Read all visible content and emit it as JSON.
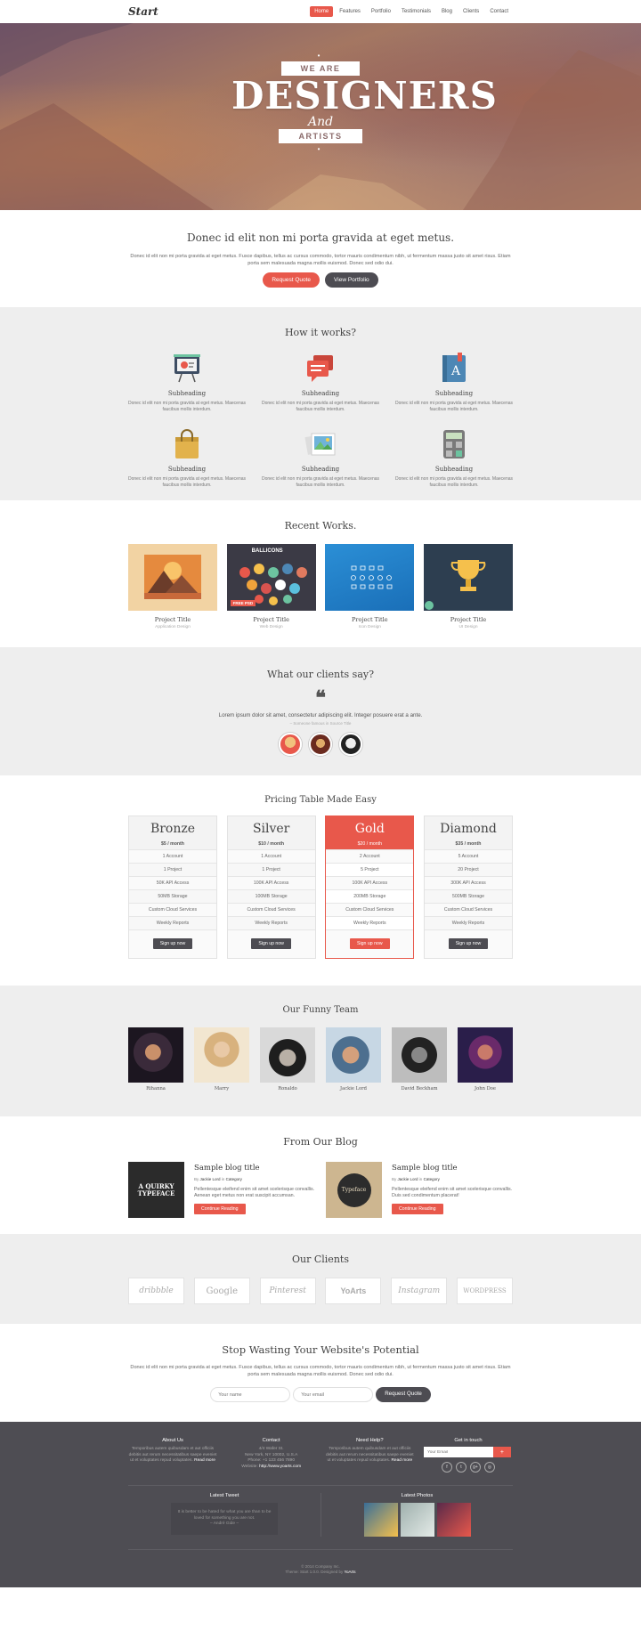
{
  "nav": {
    "logo": "Start",
    "items": [
      {
        "label": "Home"
      },
      {
        "label": "Features"
      },
      {
        "label": "Portfolio"
      },
      {
        "label": "Testimonials"
      },
      {
        "label": "Blog"
      },
      {
        "label": "Clients"
      },
      {
        "label": "Contact"
      }
    ]
  },
  "hero": {
    "ribbon_top": "WE ARE",
    "headline": "DESIGNERS",
    "connector": "And",
    "ribbon_bottom": "ARTISTS"
  },
  "intro": {
    "title": "Donec id elit non mi porta gravida at eget metus.",
    "text": "Donec id elit non mi porta gravida at eget metus. Fusce dapibus, tellus ac cursus commodo, tortor mauris condimentum nibh, ut fermentum massa justo sit amet risus. Etiam porta sem malesuada magna mollis euismod. Donec sed odio dui.",
    "primary_button": "Request Quote",
    "secondary_button": "View Portfolio"
  },
  "how": {
    "title": "How it works?",
    "features": [
      {
        "icon": "presentation-icon",
        "heading": "Subheading",
        "text": "Donec id elit non mi porta gravida at eget metus. Maecenas faucibus mollis interdum."
      },
      {
        "icon": "chat-bubbles-icon",
        "heading": "Subheading",
        "text": "Donec id elit non mi porta gravida at eget metus. Maecenas faucibus mollis interdum."
      },
      {
        "icon": "dictionary-icon",
        "heading": "Subheading",
        "text": "Donec id elit non mi porta gravida at eget metus. Maecenas faucibus mollis interdum."
      },
      {
        "icon": "shopping-bag-icon",
        "heading": "Subheading",
        "text": "Donec id elit non mi porta gravida at eget metus. Maecenas faucibus mollis interdum."
      },
      {
        "icon": "photos-icon",
        "heading": "Subheading",
        "text": "Donec id elit non mi porta gravida at eget metus. Maecenas faucibus mollis interdum."
      },
      {
        "icon": "calculator-icon",
        "heading": "Subheading",
        "text": "Donec id elit non mi porta gravida at eget metus. Maecenas faucibus mollis interdum."
      }
    ]
  },
  "works": {
    "title": "Recent Works.",
    "items": [
      {
        "title": "Project Title",
        "category": "Application Design",
        "thumb_label": ""
      },
      {
        "title": "Project Title",
        "category": "Web Design",
        "thumb_label": "BALLICONS",
        "thumb_tag": "FREE PSD"
      },
      {
        "title": "Project Title",
        "category": "Icon Design",
        "thumb_label": ""
      },
      {
        "title": "Project Title",
        "category": "UI Design",
        "thumb_label": ""
      }
    ]
  },
  "testimonials": {
    "title": "What our clients say?",
    "quote": "Lorem ipsum dolor sit amet, consectetur adipiscing elit. Integer posuere erat a ante.",
    "author": "– Someone famous in Source Title"
  },
  "pricing": {
    "title": "Pricing Table Made Easy",
    "plans": [
      {
        "name": "Bronze",
        "price": "$5 / month",
        "features": [
          "1 Account",
          "1 Project",
          "50K API Access",
          "50MB Storage",
          "Custom Cloud Services",
          "Weekly Reports"
        ],
        "button": "Sign up now"
      },
      {
        "name": "Silver",
        "price": "$10 / month",
        "features": [
          "1 Account",
          "1 Project",
          "100K API Access",
          "100MB Storage",
          "Custom Cloud Services",
          "Weekly Reports"
        ],
        "button": "Sign up now"
      },
      {
        "name": "Gold",
        "price": "$20 / month",
        "features": [
          "2 Account",
          "5 Project",
          "100K API Access",
          "200MB Storage",
          "Custom Cloud Services",
          "Weekly Reports"
        ],
        "button": "Sign up now"
      },
      {
        "name": "Diamond",
        "price": "$35 / month",
        "features": [
          "5 Account",
          "20 Project",
          "300K API Access",
          "500MB Storage",
          "Custom Cloud Services",
          "Weekly Reports"
        ],
        "button": "Sign up now"
      }
    ]
  },
  "team": {
    "title": "Our Funny Team",
    "members": [
      {
        "name": "Rihanna"
      },
      {
        "name": "Marry"
      },
      {
        "name": "Ronaldo"
      },
      {
        "name": "Jackie Lord"
      },
      {
        "name": "David Beckham"
      },
      {
        "name": "John Doe"
      }
    ]
  },
  "blog": {
    "title": "From Our Blog",
    "posts": [
      {
        "title": "Sample blog title",
        "by": "By",
        "author": "Jackie Lord",
        "in": "in",
        "category": "Category",
        "text": "Pellentesque eleifend enim sit amet scelerisque convallis. Aenean eget metus non erat suscipit accumsan.",
        "button": "Continue Reading",
        "thumb_text": "A QUIRKY TYPEFACE"
      },
      {
        "title": "Sample blog title",
        "by": "By",
        "author": "Jackie Lord",
        "in": "in",
        "category": "Category",
        "text": "Pellentesque eleifend enim sit amet scelerisque convallis. Duis sed condimentum placerat!",
        "button": "Continue Reading",
        "thumb_text": "Typeface"
      }
    ]
  },
  "clients": {
    "title": "Our Clients",
    "logos": [
      "dribbble",
      "Google",
      "Pinterest",
      "YoArts",
      "Instagram",
      "WordPress"
    ]
  },
  "cta": {
    "title": "Stop Wasting Your Website's Potential",
    "text": "Donec id elit non mi porta gravida at eget metus. Fusce dapibus, tellus ac cursus commodo, tortor mauris condimentum nibh, ut fermentum massa justo sit amet risus. Etiam porta sem malesuada magna mollis euismod. Donec sed odio dui.",
    "name_placeholder": "Your name",
    "email_placeholder": "Your email",
    "button": "Request Quote"
  },
  "footer": {
    "about": {
      "title": "About Us",
      "text": "Temporibus autem quibusdam et aut officiis debitis aut rerum necessitatibus saepe eveniet ut et voluptates repud voluptates.",
      "link": "Read more"
    },
    "contact": {
      "title": "Contact",
      "address1": "4/4 Wafer St.",
      "address2": "New York, NY 10002, U.S.A",
      "phone": "Phone: +1 123 456 7890",
      "website_label": "Website:",
      "website": "http://www.yoarts.com"
    },
    "help": {
      "title": "Need Help?",
      "text": "Temporibus autem quibusdam et aut officiis debitis aut rerum necessitatibus saepe eveniet ut et voluptates repud voluptates.",
      "link": "Read more"
    },
    "touch": {
      "title": "Get in touch",
      "placeholder": "Your Email",
      "submit": "+",
      "social": [
        "f",
        "t",
        "g+",
        "◎"
      ]
    },
    "tweet": {
      "title": "Latest Tweet",
      "text": "It is better to be hated for what you are than to be loved for something you are not.",
      "author": "– André Gide –"
    },
    "photos_title": "Latest Photos",
    "copyright": "© 2014 Company Inc.",
    "credit_prefix": "Theme: Start 1.0.0. Designed by",
    "credit": "YoArts"
  },
  "colors": {
    "accent": "#e8584b",
    "dark": "#4d4c52",
    "footer": "#4e4d53"
  }
}
